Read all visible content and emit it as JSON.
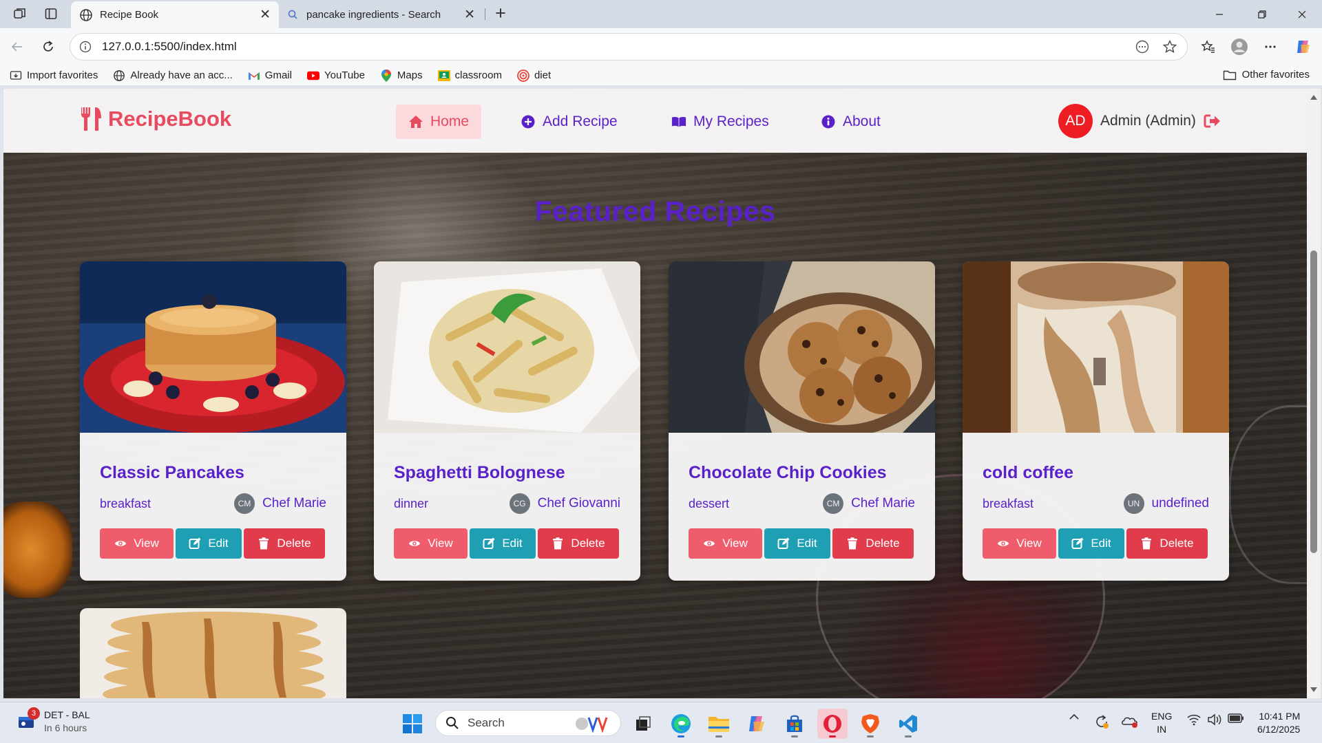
{
  "browser": {
    "tabs": [
      {
        "title": "Recipe Book",
        "active": true
      },
      {
        "title": "pancake ingredients - Search",
        "active": false
      }
    ],
    "url": "127.0.0.1:5500/index.html",
    "favorites": [
      {
        "label": "Import favorites",
        "icon": "import-icon"
      },
      {
        "label": "Already have an acc...",
        "icon": "globe-icon"
      },
      {
        "label": "Gmail",
        "icon": "gmail-icon"
      },
      {
        "label": "YouTube",
        "icon": "youtube-icon"
      },
      {
        "label": "Maps",
        "icon": "maps-icon"
      },
      {
        "label": "classroom",
        "icon": "classroom-icon"
      },
      {
        "label": "diet",
        "icon": "diet-icon"
      }
    ],
    "other_favorites": "Other favorites"
  },
  "site": {
    "brand": "RecipeBook",
    "nav": [
      {
        "label": "Home",
        "icon": "home-icon",
        "active": true
      },
      {
        "label": "Add Recipe",
        "icon": "plus-circle-icon",
        "active": false
      },
      {
        "label": "My Recipes",
        "icon": "book-icon",
        "active": false
      },
      {
        "label": "About",
        "icon": "info-icon",
        "active": false
      }
    ],
    "user": {
      "initials": "AD",
      "name": "Admin (Admin)"
    },
    "colors": {
      "brand": "#e84a5f",
      "purple": "#5a21c9",
      "view": "#ef5d6d",
      "edit": "#1e9fb4",
      "delete": "#e03c4b"
    }
  },
  "main": {
    "title": "Featured Recipes",
    "buttons": {
      "view": "View",
      "edit": "Edit",
      "delete": "Delete"
    },
    "recipes": [
      {
        "title": "Classic Pancakes",
        "category": "breakfast",
        "chef_initials": "CM",
        "chef": "Chef Marie",
        "image": "pancakes"
      },
      {
        "title": "Spaghetti Bolognese",
        "category": "dinner",
        "chef_initials": "CG",
        "chef": "Chef Giovanni",
        "image": "pasta"
      },
      {
        "title": "Chocolate Chip Cookies",
        "category": "dessert",
        "chef_initials": "CM",
        "chef": "Chef Marie",
        "image": "cookies"
      },
      {
        "title": "cold coffee",
        "category": "breakfast",
        "chef_initials": "UN",
        "chef": "undefined",
        "image": "cold-coffee"
      }
    ]
  },
  "taskbar": {
    "weather": {
      "title": "DET - BAL",
      "subtitle": "In 6 hours",
      "badge": "3"
    },
    "search_placeholder": "Search",
    "language": {
      "line1": "ENG",
      "line2": "IN"
    },
    "clock": {
      "time": "10:41 PM",
      "date": "6/12/2025"
    }
  }
}
